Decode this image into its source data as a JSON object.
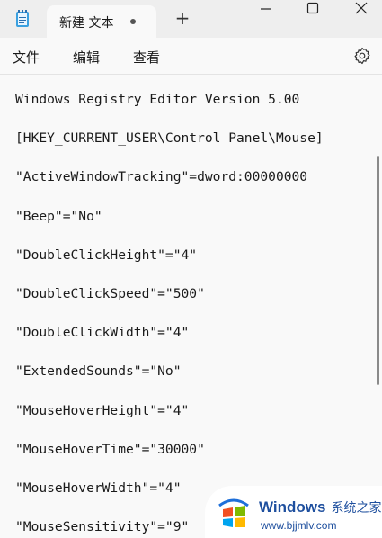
{
  "tab": {
    "title": "新建 文本"
  },
  "menu": {
    "file": "文件",
    "edit": "编辑",
    "view": "查看"
  },
  "lines": [
    "Windows Registry Editor Version 5.00",
    "[HKEY_CURRENT_USER\\Control Panel\\Mouse]",
    "\"ActiveWindowTracking\"=dword:00000000",
    "\"Beep\"=\"No\"",
    "\"DoubleClickHeight\"=\"4\"",
    "\"DoubleClickSpeed\"=\"500\"",
    "\"DoubleClickWidth\"=\"4\"",
    "\"ExtendedSounds\"=\"No\"",
    "\"MouseHoverHeight\"=\"4\"",
    "\"MouseHoverTime\"=\"30000\"",
    "\"MouseHoverWidth\"=\"4\"",
    "\"MouseSensitivity\"=\"9\""
  ],
  "watermark": {
    "brand": "Windows",
    "cn": "系统之家",
    "url": "www.bjjmlv.com"
  },
  "colors": {
    "accent": "#1e4f9e",
    "background": "#f9f9f9"
  }
}
